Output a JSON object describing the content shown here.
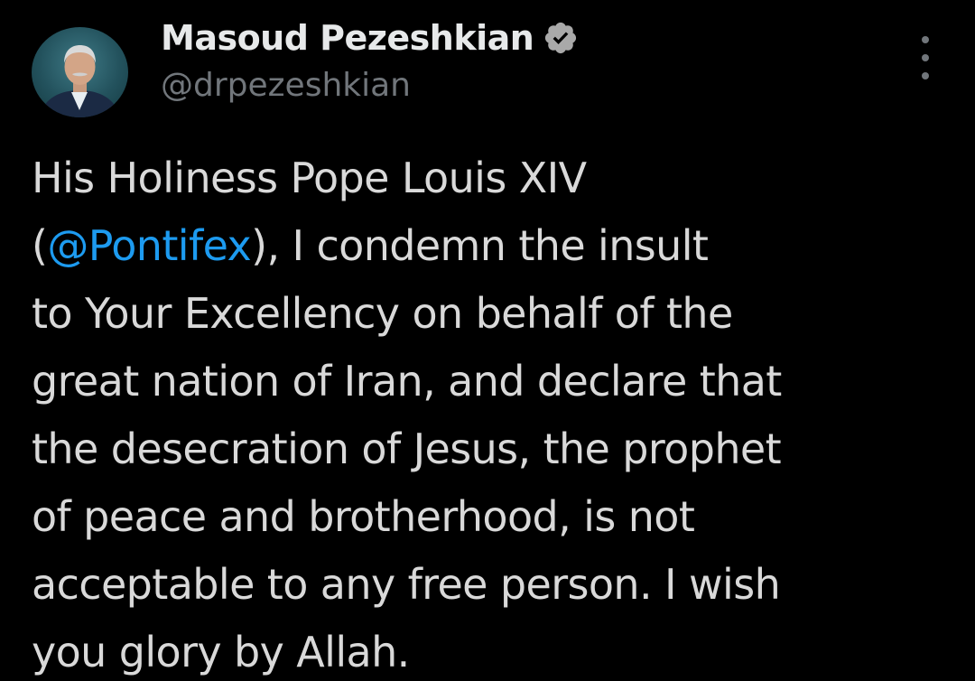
{
  "author": {
    "display_name": "Masoud Pezeshkian",
    "handle": "@drpezeshkian",
    "verified": true
  },
  "tweet": {
    "lines": [
      {
        "text": "His Holiness Pope Louis XIV"
      },
      {
        "before": "(",
        "mention": "@Pontifex",
        "after": "), I condemn the insult"
      },
      {
        "text": "to Your Excellency on behalf of the"
      },
      {
        "text": "great nation of Iran, and declare that"
      },
      {
        "text": "the desecration of Jesus, the prophet"
      },
      {
        "text": "of peace and brotherhood, is not"
      },
      {
        "text": "acceptable to any free person. I wish"
      },
      {
        "text": "you glory by Allah."
      }
    ]
  },
  "icons": {
    "verified": "verified-badge-icon",
    "more": "more-options-icon"
  },
  "colors": {
    "background": "#000000",
    "name": "#e7e9ea",
    "handle": "#71767b",
    "body_text": "#d9d9d9",
    "mention": "#1d9bf0",
    "badge": "#a9a9a9"
  }
}
